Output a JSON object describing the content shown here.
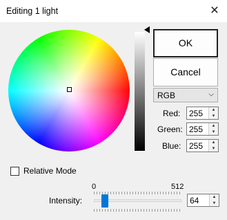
{
  "window": {
    "title": "Editing 1 light",
    "close_glyph": "✕"
  },
  "buttons": {
    "ok": "OK",
    "cancel": "Cancel"
  },
  "color_mode": {
    "selected": "RGB",
    "arrow": "⌵"
  },
  "channels": [
    {
      "label": "Red:",
      "value": "255"
    },
    {
      "label": "Green:",
      "value": "255"
    },
    {
      "label": "Blue:",
      "value": "255"
    }
  ],
  "spin_glyphs": {
    "up": "▲",
    "down": "▼"
  },
  "relative_mode": {
    "label": "Relative Mode",
    "checked": false
  },
  "intensity": {
    "label": "Intensity:",
    "min_label": "0",
    "max_label": "512",
    "min": 0,
    "max": 512,
    "value": "64",
    "slider_value": 64
  },
  "brightness_level": 1.0
}
